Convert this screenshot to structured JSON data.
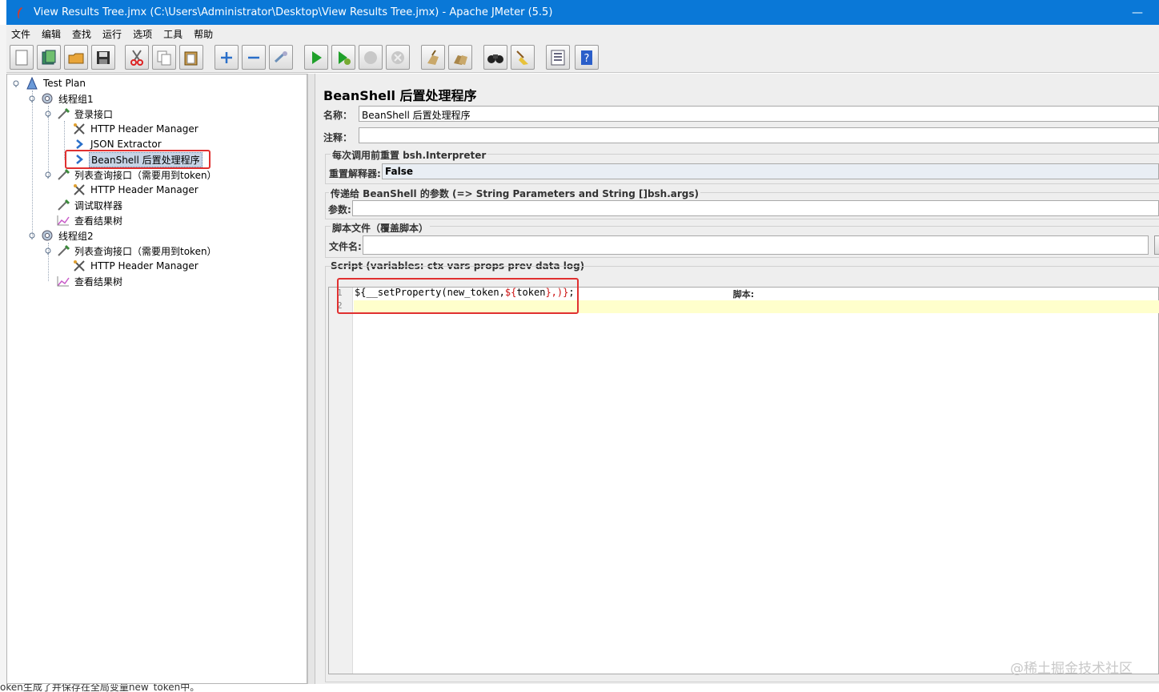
{
  "window": {
    "title": "View Results Tree.jmx (C:\\Users\\Administrator\\Desktop\\View Results Tree.jmx) - Apache JMeter (5.5)",
    "minimize_glyph": "—"
  },
  "menu": [
    "文件",
    "编辑",
    "查找",
    "运行",
    "选项",
    "工具",
    "帮助"
  ],
  "toolbar_icons": [
    "new-icon",
    "templates-icon",
    "open-icon",
    "save-icon",
    "cut-icon",
    "copy-icon",
    "paste-icon",
    "expand-icon",
    "collapse-icon",
    "toggle-icon",
    "start-icon",
    "start-no-pause-icon",
    "stop-icon",
    "shutdown-icon",
    "clear-icon",
    "clear-all-icon",
    "search-icon",
    "reset-search-icon",
    "function-helper-icon",
    "help-icon"
  ],
  "tree": {
    "nodes": [
      {
        "label": "Test Plan",
        "icon": "test-plan-icon"
      },
      {
        "label": "线程组1",
        "icon": "thread-group-icon"
      },
      {
        "label": "登录接口",
        "icon": "sampler-icon"
      },
      {
        "label": "HTTP Header Manager",
        "icon": "config-tools-icon"
      },
      {
        "label": "JSON Extractor",
        "icon": "post-processor-icon"
      },
      {
        "label": "BeanShell 后置处理程序",
        "icon": "post-processor-icon"
      },
      {
        "label": "列表查询接口（需要用到token）",
        "icon": "sampler-icon"
      },
      {
        "label": "HTTP Header Manager",
        "icon": "config-tools-icon"
      },
      {
        "label": "调试取样器",
        "icon": "sampler-icon"
      },
      {
        "label": "查看结果树",
        "icon": "listener-icon"
      },
      {
        "label": "线程组2",
        "icon": "thread-group-icon"
      },
      {
        "label": "列表查询接口（需要用到token）",
        "icon": "sampler-icon"
      },
      {
        "label": "HTTP Header Manager",
        "icon": "config-tools-icon"
      },
      {
        "label": "查看结果树",
        "icon": "listener-icon"
      }
    ]
  },
  "editor_panel": {
    "title": "BeanShell 后置处理程序",
    "name_label": "名称：",
    "name_value": "BeanShell 后置处理程序",
    "comment_label": "注释：",
    "comment_value": "",
    "reset_group_title": "每次调用前重置 bsh.Interpreter",
    "reset_label": "重置解释器:",
    "reset_value": "False",
    "params_group_title": "传递给 BeanShell 的参数 (=> String Parameters and String []bsh.args)",
    "params_label": "参数:",
    "params_value": "",
    "script_file_group_title": "脚本文件（覆盖脚本）",
    "file_name_label": "文件名:",
    "file_name_value": "",
    "script_group_title": "Script (variables: ctx vars props prev data log)",
    "script_header": "脚本:",
    "line_numbers": [
      "1",
      "2"
    ],
    "script_parts": {
      "p1": "${",
      "p2": "__setProperty",
      "p3": "(new_token,",
      "p4": "${",
      "p5": "token",
      "p6": "},",
      "p7": ")}",
      "p8": ";"
    }
  },
  "bottom_caption": "oken生成了并保存在全局变量new_token中。",
  "watermark": "@稀土掘金技术社区"
}
